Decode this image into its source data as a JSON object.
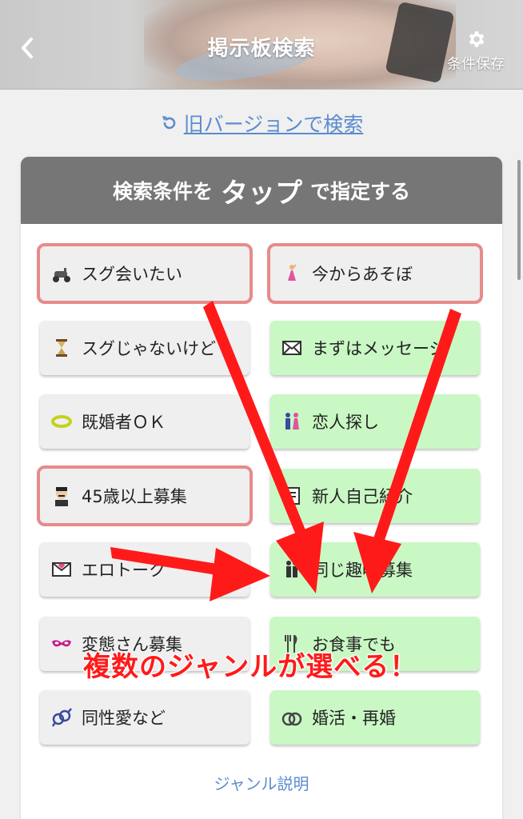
{
  "header": {
    "title": "掲示板検索",
    "save_label": "条件保存"
  },
  "old_version_link": "旧バージョンで検索",
  "panel": {
    "heading_prefix": "検索条件を",
    "heading_big": "タップ",
    "heading_suffix": "で指定する"
  },
  "genres": [
    {
      "label": "スグ会いたい",
      "icon": "scooter-icon",
      "style": "gray",
      "selected": true
    },
    {
      "label": "今からあそぼ",
      "icon": "dancer-icon",
      "style": "gray",
      "selected": true
    },
    {
      "label": "スグじゃないけど",
      "icon": "hourglass-icon",
      "style": "gray",
      "selected": false
    },
    {
      "label": "まずはメッセージ",
      "icon": "envelope-icon",
      "style": "green",
      "selected": false
    },
    {
      "label": "既婚者ＯＫ",
      "icon": "ring-icon",
      "style": "gray",
      "selected": false
    },
    {
      "label": "恋人探し",
      "icon": "couple-icon",
      "style": "green",
      "selected": false
    },
    {
      "label": "45歳以上募集",
      "icon": "gentleman-icon",
      "style": "gray",
      "selected": true
    },
    {
      "label": "新人自己紹介",
      "icon": "note-icon",
      "style": "green",
      "selected": false
    },
    {
      "label": "エロトーク",
      "icon": "love-letter-icon",
      "style": "gray",
      "selected": false
    },
    {
      "label": "同じ趣味募集",
      "icon": "people-icon",
      "style": "green",
      "selected": false
    },
    {
      "label": "変態さん募集",
      "icon": "mask-icon",
      "style": "gray",
      "selected": false
    },
    {
      "label": "お食事でも",
      "icon": "fork-knife-icon",
      "style": "green",
      "selected": false
    },
    {
      "label": "同性愛など",
      "icon": "gender-icon",
      "style": "gray",
      "selected": false
    },
    {
      "label": "婚活・再婚",
      "icon": "rings-icon",
      "style": "green",
      "selected": false
    }
  ],
  "genre_help_link": "ジャンル説明",
  "annotation": {
    "caption": "複数のジャンルが選べる！",
    "arrow_color": "#ff1a1a"
  },
  "colors": {
    "header_text": "#ffffff",
    "link": "#5b8ccf",
    "panel_head_bg": "#767676",
    "green_button": "#c9f8c4",
    "gray_button": "#efefef",
    "selected_outline": "#e88a8a"
  }
}
